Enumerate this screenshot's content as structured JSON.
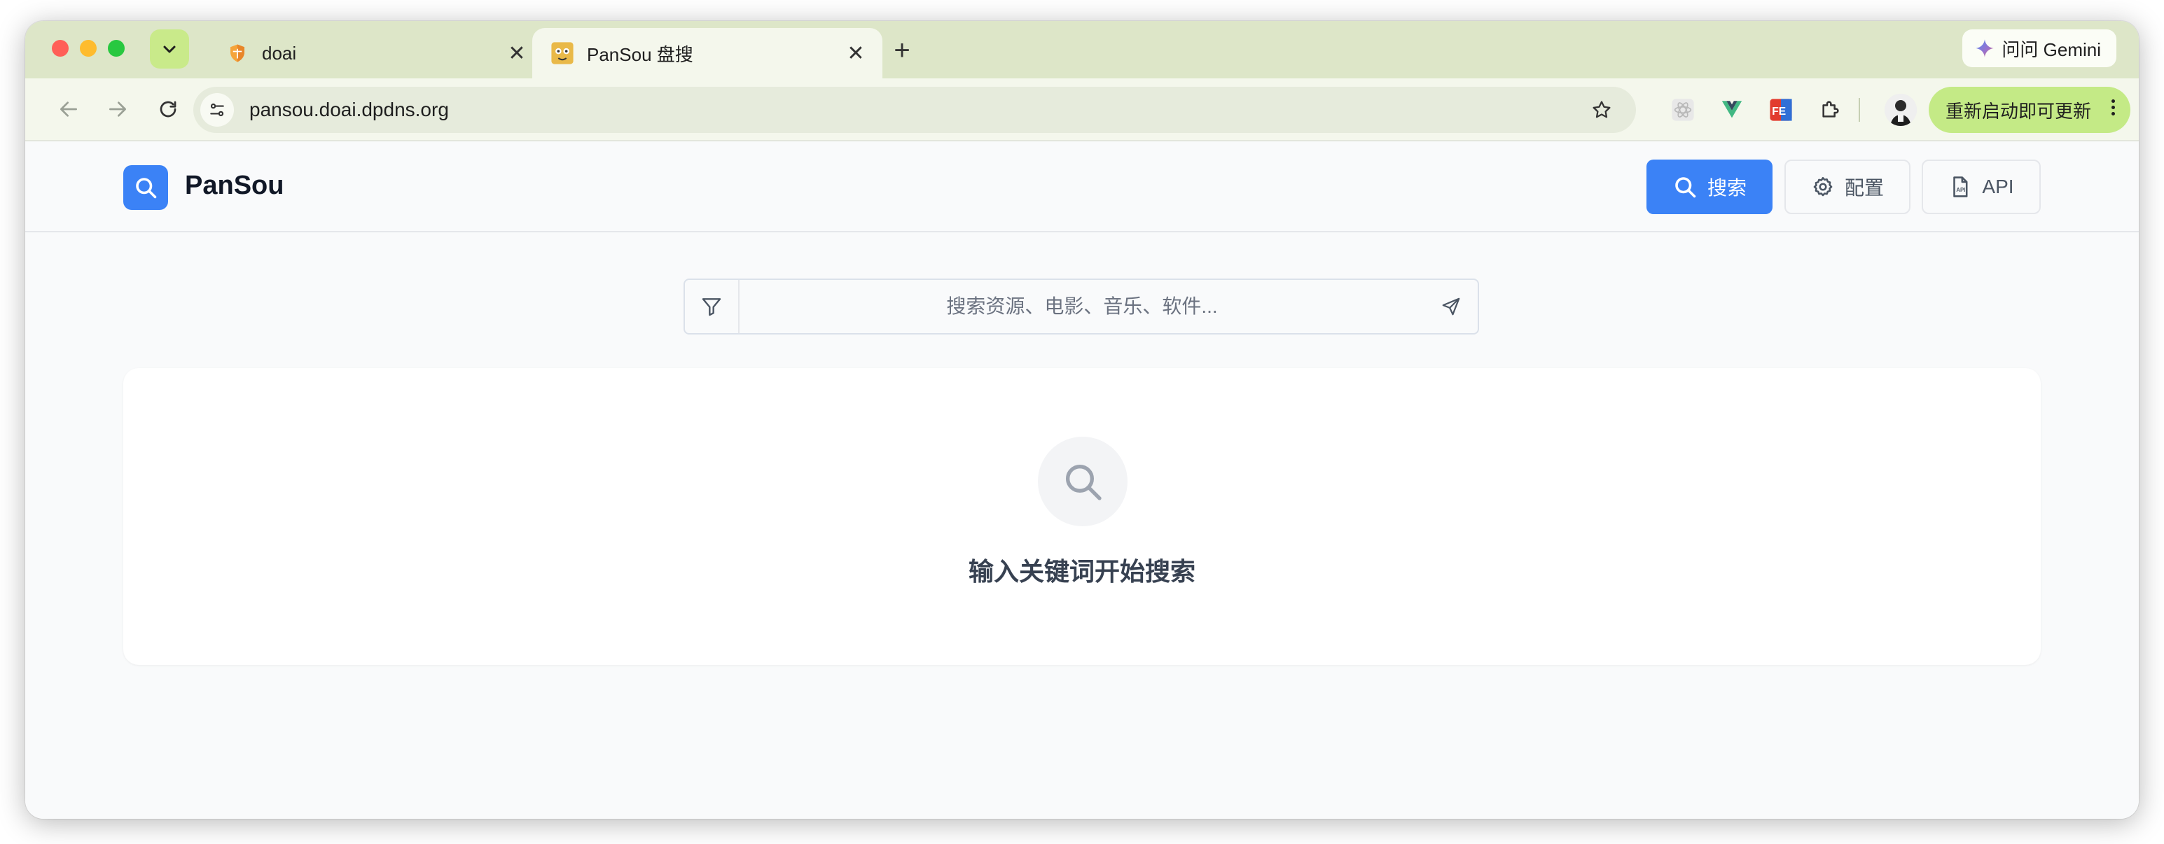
{
  "browser": {
    "tabs": [
      {
        "title": "doai",
        "close": "✕"
      },
      {
        "title": "PanSou 盘搜",
        "close": "✕"
      }
    ],
    "new_tab": "+",
    "gemini_label": "问问 Gemini",
    "address": "pansou.doai.dpdns.org",
    "update_label": "重新启动即可更新",
    "accent": "#c4ea86"
  },
  "app": {
    "brand": "PanSou",
    "nav": {
      "search": "搜索",
      "config": "配置",
      "api": "API"
    },
    "search": {
      "placeholder": "搜索资源、电影、音乐、软件..."
    },
    "empty_state": "输入关键词开始搜索",
    "primary_color": "#3b82f6"
  }
}
